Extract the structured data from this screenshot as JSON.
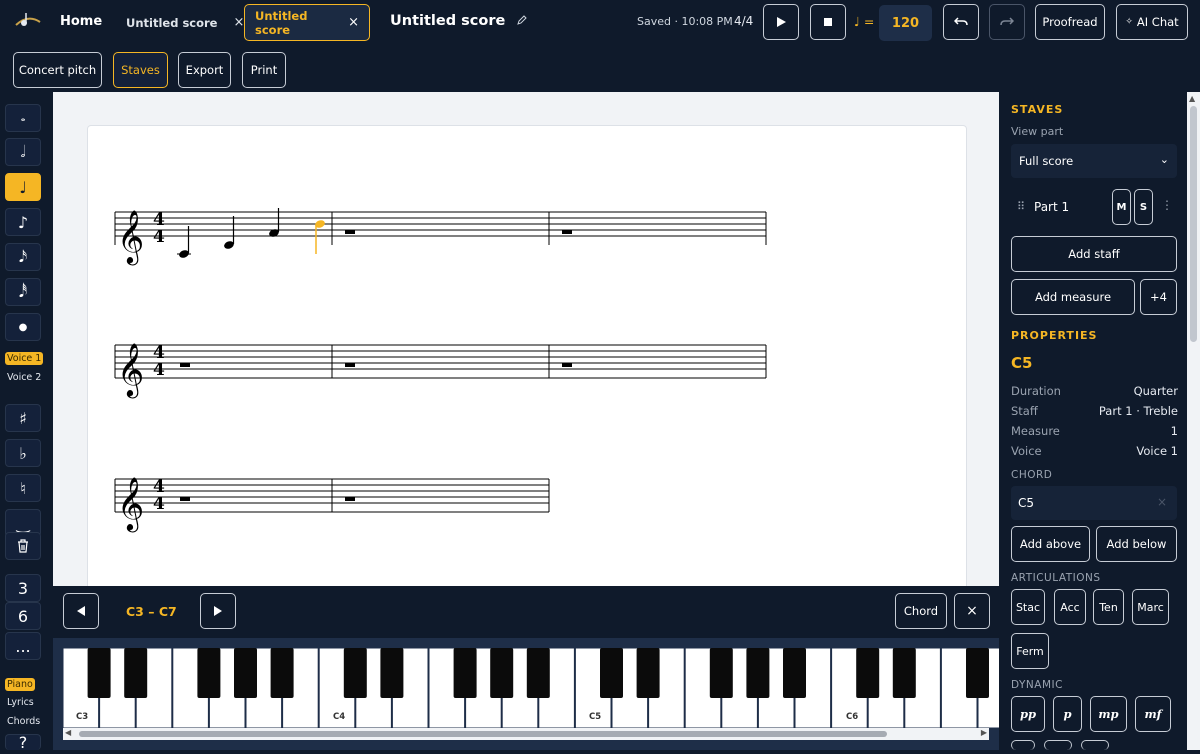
{
  "topbar": {
    "home": "Home",
    "tabs": [
      {
        "label": "Untitled score",
        "close": "×"
      },
      {
        "label": "Untitled score",
        "close": "×"
      }
    ],
    "title": "Untitled score",
    "saved": "Saved · 10:08 PM",
    "time_signature": "4/4",
    "tempo_symbol": "♩ =",
    "tempo": "120",
    "proofread": "Proofread",
    "ai_chat": "AI Chat"
  },
  "toolbar2": {
    "concert_pitch": "Concert pitch",
    "staves": "Staves",
    "export": "Export",
    "print": "Print"
  },
  "left": {
    "voice1": "Voice 1",
    "voice2": "Voice 2",
    "tuplet3": "3",
    "tuplet6": "6",
    "more": "...",
    "piano": "Piano",
    "lyrics": "Lyrics",
    "chords": "Chords",
    "help": "?"
  },
  "keyboard": {
    "range": "C3 – C7",
    "chord": "Chord",
    "close": "×",
    "labels": [
      "C3",
      "C4",
      "C5",
      "C6"
    ]
  },
  "panel": {
    "staves_header": "STAVES",
    "view_part": "View part",
    "view_part_value": "Full score",
    "part_name": "Part 1",
    "mute": "M",
    "solo": "S",
    "add_staff": "Add staff",
    "add_measure": "Add measure",
    "plus4": "+4",
    "properties_header": "PROPERTIES",
    "note_name": "C5",
    "props": [
      {
        "k": "Duration",
        "v": "Quarter"
      },
      {
        "k": "Staff",
        "v": "Part 1 · Treble"
      },
      {
        "k": "Measure",
        "v": "1"
      },
      {
        "k": "Voice",
        "v": "Voice 1"
      }
    ],
    "chord_header": "CHORD",
    "chord_value": "C5",
    "chord_clear": "×",
    "add_above": "Add above",
    "add_below": "Add below",
    "articulations_header": "ARTICULATIONS",
    "articulations": [
      "Stac",
      "Acc",
      "Ten",
      "Marc",
      "Ferm"
    ],
    "dynamic_header": "DYNAMIC",
    "dynamics": [
      "pp",
      "p",
      "mp",
      "mf"
    ]
  },
  "colors": {
    "accent": "#f5b624",
    "bg": "#0f1a2b"
  }
}
